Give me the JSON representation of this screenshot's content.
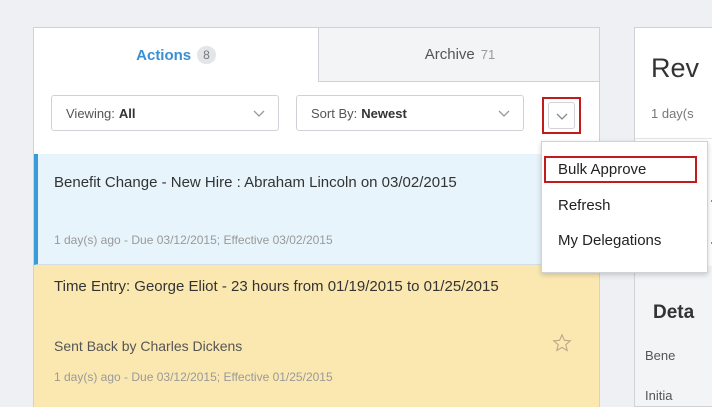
{
  "tabs": {
    "actions_label": "Actions",
    "actions_count": "8",
    "archive_label": "Archive",
    "archive_count": "71"
  },
  "filters": {
    "viewing_label": "Viewing:",
    "viewing_value": "All",
    "sort_label": "Sort By:",
    "sort_value": "Newest"
  },
  "menu": {
    "items": [
      "Bulk Approve",
      "Refresh",
      "My Delegations"
    ]
  },
  "tasks": [
    {
      "title": "Benefit Change - New Hire : Abraham Lincoln on 03/02/2015",
      "meta": "1 day(s) ago - Due 03/12/2015; Effective 03/02/2015"
    },
    {
      "title": "Time Entry: George Eliot - 23 hours from 01/19/2015 to 01/25/2015",
      "status": "Sent Back by Charles Dickens",
      "meta": "1 day(s) ago - Due 03/12/2015; Effective 01/25/2015"
    }
  ],
  "detail_panel": {
    "title": "Rev",
    "subtitle": "1 day(s",
    "section_title": "Deta",
    "line1": "Bene",
    "line2": "Initia"
  },
  "colors": {
    "accent": "#3a8fd2",
    "highlight_border": "#c11b1b",
    "selected_row_bg": "#e7f4fb",
    "pending_row_bg": "#fbe8b1"
  },
  "icons": [
    "chevron-down-icon",
    "star-icon"
  ]
}
